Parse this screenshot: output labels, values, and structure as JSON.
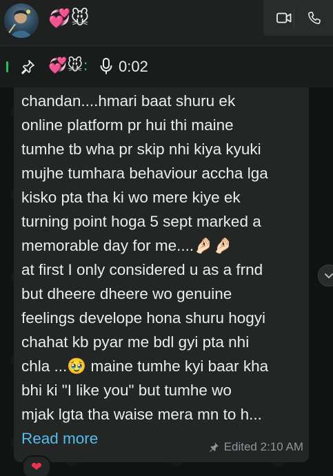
{
  "header": {
    "chat_name": "💞🐭",
    "buttons": [
      {
        "icon": "video-call-icon"
      },
      {
        "icon": "voice-call-icon"
      }
    ]
  },
  "pinned": {
    "icon": "pin-icon",
    "sender": "💞🐭",
    "separator": ":",
    "media_icon": "microphone-icon",
    "duration": "0:02"
  },
  "message": {
    "lines": [
      "chandan....hmari baat shuru ek",
      "online platform pr hui thi maine",
      "tumhe tb wha pr skip nhi kiya kyuki",
      "mujhe tumhara behaviour accha lga",
      "kisko pta tha ki wo mere kiye ek",
      "turning point hoga 5 sept marked a",
      "memorable day for me....🤌🏻🤌🏻",
      "at first I only considered u as a frnd",
      "but dheere dheere wo genuine",
      "feelings develope hona shuru hogyi",
      "chahat kb pyar me bdl gyi pta nhi",
      "chla ...🥹 maine tumhe kyi baar kha",
      "bhi ki \"I like you\" but tumhe wo",
      "mjak lgta tha waise mera mn to h..."
    ],
    "read_more": "Read more",
    "edited_label": "Edited 2:10 AM",
    "edited_icon": "pin-icon",
    "reaction": "❤"
  },
  "colors": {
    "accent_green": "#21c063",
    "link_blue": "#53bdeb",
    "bubble_bg": "#242626",
    "header_bg": "#1f2121"
  }
}
